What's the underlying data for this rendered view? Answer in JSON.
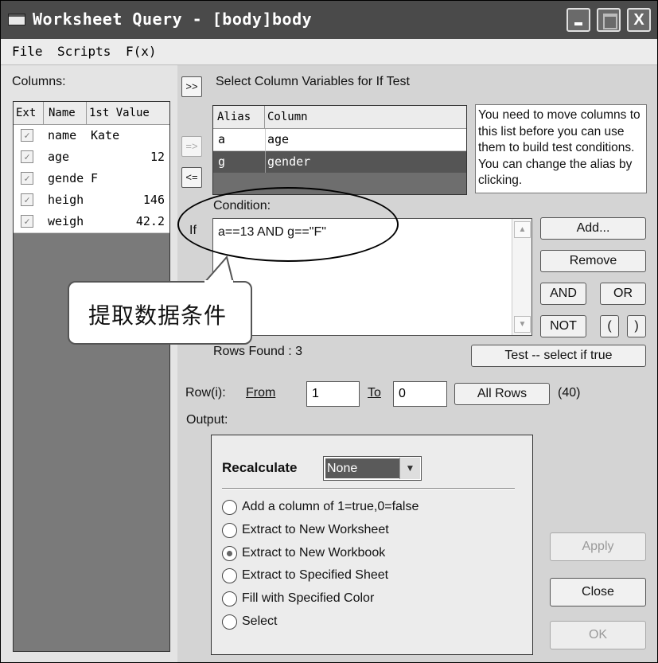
{
  "window": {
    "title": "Worksheet Query - [body]body",
    "controls": {
      "minimize": "_",
      "maximize": "□",
      "close": "X"
    }
  },
  "menu": [
    "File",
    "Scripts",
    "F(x)"
  ],
  "columns_panel": {
    "label": "Columns:",
    "headers": [
      "Ext",
      "Name",
      "1st Value"
    ],
    "rows": [
      {
        "name": "name",
        "value": "Kate",
        "checked": true
      },
      {
        "name": "age",
        "value": "12",
        "checked": true
      },
      {
        "name": "gende",
        "value": "F",
        "checked": true
      },
      {
        "name": "heigh",
        "value": "146",
        "checked": true
      },
      {
        "name": "weigh",
        "value": "42.2",
        "checked": true
      }
    ]
  },
  "move_buttons": {
    "add_all": ">>",
    "add": "=>",
    "remove": "<="
  },
  "select_label": "Select Column Variables for If Test",
  "alias_table": {
    "headers": [
      "Alias",
      "Column"
    ],
    "rows": [
      {
        "alias": "a",
        "column": "age",
        "selected": false
      },
      {
        "alias": "g",
        "column": "gender",
        "selected": true
      }
    ]
  },
  "info_text": "You need to move columns to this list before you can use them to build test conditions. You can change the alias by clicking.",
  "condition": {
    "label": "Condition:",
    "if_label": "If",
    "text": "a==13 AND g==\"F\""
  },
  "callout_text": "提取数据条件",
  "condition_buttons": {
    "add": "Add...",
    "remove": "Remove",
    "and": "AND",
    "or": "OR",
    "not": "NOT",
    "open_paren": "(",
    "close_paren": ")",
    "test": "Test -- select if true"
  },
  "rows_found": "Rows Found : 3",
  "row_range": {
    "label": "Row(i):",
    "from_label": "From",
    "from_value": "1",
    "to_label": "To",
    "to_value": "0",
    "all_rows": "All Rows",
    "count": "(40)"
  },
  "output": {
    "label": "Output:",
    "recalculate_label": "Recalculate",
    "recalculate_value": "None",
    "options": [
      {
        "label": "Add a column of 1=true,0=false",
        "selected": false
      },
      {
        "label": "Extract to New Worksheet",
        "selected": false
      },
      {
        "label": "Extract to New Workbook",
        "selected": true
      },
      {
        "label": "Extract to Specified Sheet",
        "selected": false
      },
      {
        "label": "Fill with Specified Color",
        "selected": false
      },
      {
        "label": "Select",
        "selected": false
      }
    ]
  },
  "dialog_buttons": {
    "apply": "Apply",
    "close": "Close",
    "ok": "OK"
  }
}
